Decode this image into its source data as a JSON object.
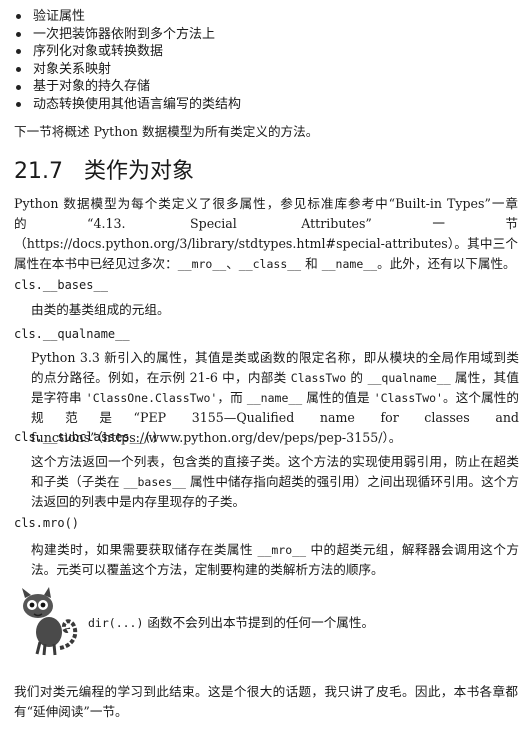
{
  "bullets": [
    "验证属性",
    "一次把装饰器依附到多个方法上",
    "序列化对象或转换数据",
    "对象关系映射",
    "基于对象的持久存储",
    "动态转换使用其他语言编写的类结构"
  ],
  "intro": "下一节将概述 Python 数据模型为所有类定义的方法。",
  "section": {
    "number": "21.7",
    "title": "类作为对象"
  },
  "para1": {
    "a": "Python 数据模型为每个类定义了很多属性，参见标准库参考中“Built-in Types”一章的“4.13. Special Attributes”一节（https://docs.python.org/3/library/stdtypes.html#special-attributes）。其中三个属性在本书中已经见过多次：",
    "c1": "__mro__",
    "b": "、",
    "c2": "__class__",
    "c": " 和 ",
    "c3": "__name__",
    "d": "。此外，还有以下属性。"
  },
  "defs": {
    "bases": {
      "term": "cls.__bases__",
      "desc": "由类的基类组成的元组。"
    },
    "qualname": {
      "term": "cls.__qualname__",
      "a": "Python 3.3 新引入的属性，其值是类或函数的限定名称，即从模块的全局作用域到类的点分路径。例如，在示例 21-6 中，内部类 ",
      "c1": "ClassTwo",
      "b": " 的 ",
      "c2": "__qualname__",
      "c": " 属性，其值是字符串 ",
      "c3": "'ClassOne.ClassTwo'",
      "d": "，而 ",
      "c4": "__name__",
      "e": " 属性的值是 ",
      "c5": "'ClassTwo'",
      "f": "。这个属性的规范是“PEP 3155—Qualified name for classes and functions”（https://www.python.org/dev/peps/pep-3155/）。"
    },
    "subclasses": {
      "term": "cls.__subclasses__()",
      "a": "这个方法返回一个列表，包含类的直接子类。这个方法的实现使用弱引用，防止在超类和子类（子类在 ",
      "c1": "__bases__",
      "b": " 属性中储存指向超类的强引用）之间出现循环引用。这个方法返回的列表中是内存里现存的子类。"
    },
    "mro": {
      "term": "cls.mro()",
      "a": "构建类时，如果需要获取储存在类属性 ",
      "c1": "__mro__",
      "b": " 中的超类元组，解释器会调用这个方法。元类可以覆盖这个方法，定制要构建的类解析方法的顺序。"
    }
  },
  "note": {
    "icon": "lemur-icon",
    "code": "dir(...)",
    "text": " 函数不会列出本节提到的任何一个属性。"
  },
  "closing": "我们对类元编程的学习到此结束。这是个很大的话题，我只讲了皮毛。因此，本书各章都有“延伸阅读”一节。"
}
